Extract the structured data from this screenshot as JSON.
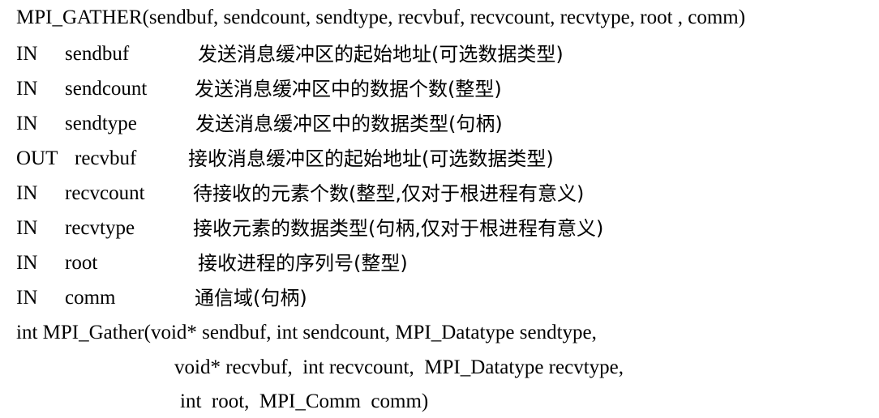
{
  "doc": {
    "heading": "MPI_GATHER(sendbuf, sendcount, sendtype, recvbuf, recvcount, recvtype, root , comm)",
    "params": [
      {
        "dir": "IN",
        "name": "sendbuf",
        "desc": "发送消息缓冲区的起始地址(可选数据类型)"
      },
      {
        "dir": "IN",
        "name": "sendcount",
        "desc": "发送消息缓冲区中的数据个数(整型)"
      },
      {
        "dir": "IN",
        "name": "sendtype",
        "desc": "发送消息缓冲区中的数据类型(句柄)"
      },
      {
        "dir": "OUT",
        "name": "recvbuf",
        "desc": "接收消息缓冲区的起始地址(可选数据类型)"
      },
      {
        "dir": "IN",
        "name": "recvcount",
        "desc": "待接收的元素个数(整型,仅对于根进程有意义)"
      },
      {
        "dir": "IN",
        "name": "recvtype",
        "desc": "接收元素的数据类型(句柄,仅对于根进程有意义)"
      },
      {
        "dir": "IN",
        "name": "root",
        "desc": "接收进程的序列号(整型)"
      },
      {
        "dir": "IN",
        "name": "comm",
        "desc": "通信域(句柄)"
      }
    ],
    "signature": [
      "int MPI_Gather(void* sendbuf, int sendcount, MPI_Datatype sendtype,",
      "void* recvbuf,  int recvcount,  MPI_Datatype recvtype,",
      "int  root,  MPI_Comm  comm)"
    ]
  }
}
